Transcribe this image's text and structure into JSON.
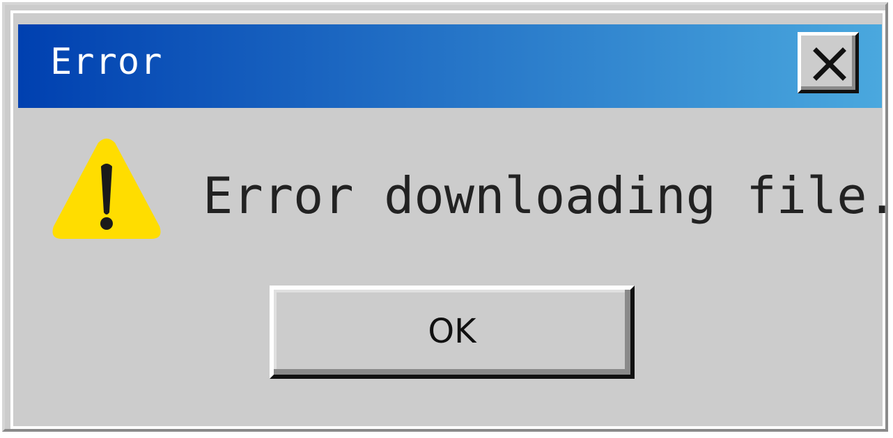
{
  "window": {
    "title": "Error",
    "close_icon": "close-icon"
  },
  "body": {
    "icon": "warning-icon",
    "message": "Error downloading file."
  },
  "buttons": {
    "ok_label": "OK"
  },
  "colors": {
    "titlebar_start": "#0040b0",
    "titlebar_end": "#4aa8de",
    "dialog_background": "#cccccc",
    "warning_fill": "#ffdd00",
    "text": "#222222"
  }
}
